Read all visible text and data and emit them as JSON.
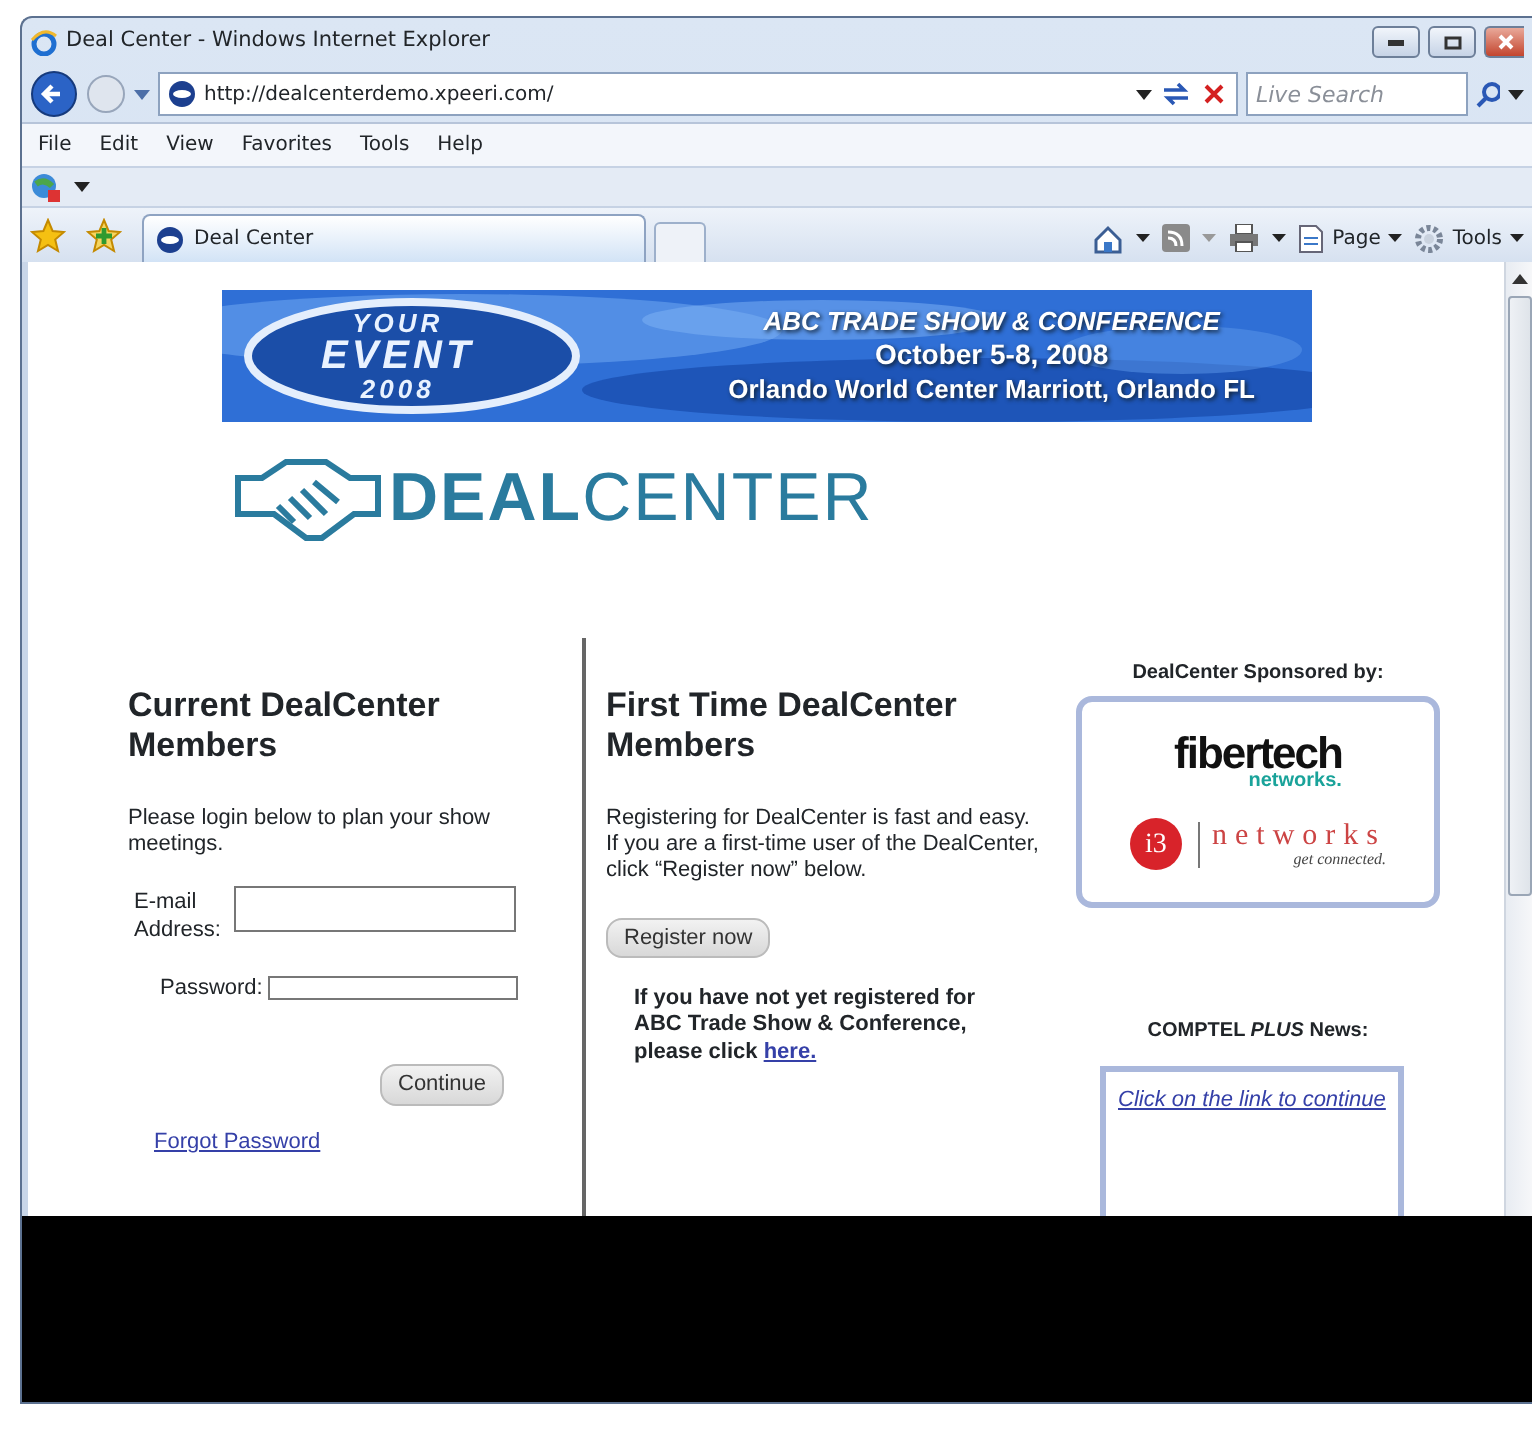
{
  "window": {
    "title": "Deal Center - Windows Internet Explorer"
  },
  "address_bar": {
    "url": "http://dealcenterdemo.xpeeri.com/"
  },
  "search": {
    "placeholder": "Live Search"
  },
  "menu": [
    "File",
    "Edit",
    "View",
    "Favorites",
    "Tools",
    "Help"
  ],
  "tabs": [
    {
      "label": "Deal Center",
      "selected": true
    }
  ],
  "command_bar": [
    "Page",
    "Tools"
  ],
  "banner": {
    "badge": [
      "YOUR",
      "EVENT",
      "2008"
    ],
    "lines": [
      "ABC TRADE SHOW & CONFERENCE",
      "October 5-8, 2008",
      "Orlando World Center Marriott, Orlando FL"
    ]
  },
  "logo": "**DEAL**CENTER",
  "members": {
    "heading": "Current DealCenter Members",
    "intro": "Please login below to plan your show meetings.",
    "email_label": "E-mail Address:",
    "password_label": "Password:",
    "button": "Continue",
    "forgot": "Forgot Password"
  },
  "first_time": {
    "heading": "First Time DealCenter Members",
    "intro": [
      "Registering for DealCenter is fast and easy.",
      "If you are a first-time user of the DealCenter,",
      "click “Register now” below."
    ],
    "button": "Register now",
    "note": "If you have not yet registered for ABC Trade Show & Conference, please click",
    "link": "here."
  },
  "sponsors": {
    "title": "DealCenter Sponsored by:",
    "fibertech": [
      "fibertech",
      "networks."
    ],
    "i3": [
      "i3",
      "networks",
      "get connected."
    ]
  },
  "news": {
    "title": "COMPTEL *PLUS* News:",
    "links": [
      "Click on the link to continue"
    ]
  }
}
